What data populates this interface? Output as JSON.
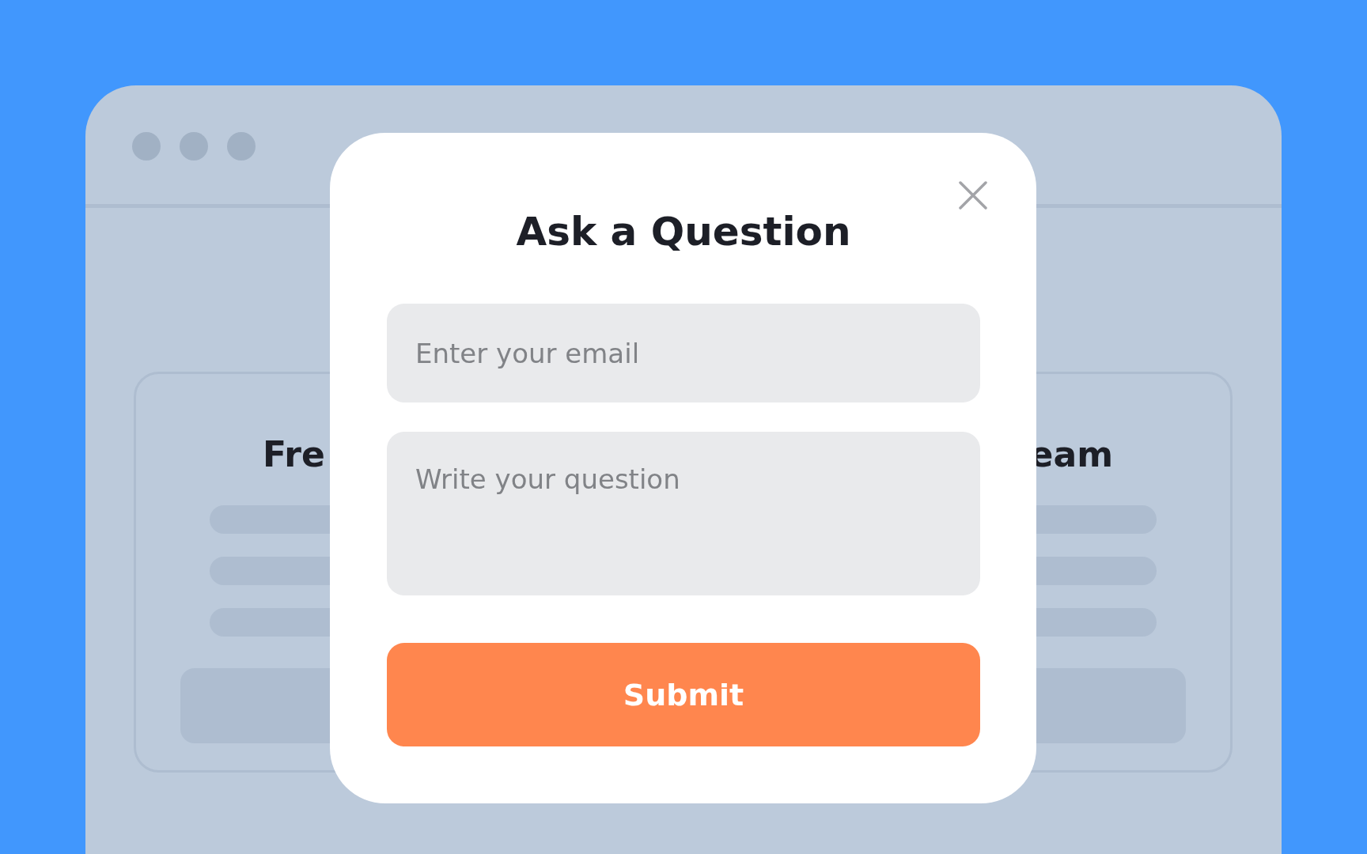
{
  "background_cards": [
    {
      "title": "Fre"
    },
    {
      "title": "eam"
    }
  ],
  "modal": {
    "title": "Ask a Question",
    "email_field": {
      "placeholder": "Enter your email"
    },
    "question_field": {
      "placeholder": "Write your question"
    },
    "submit_button": {
      "label": "Submit"
    }
  }
}
